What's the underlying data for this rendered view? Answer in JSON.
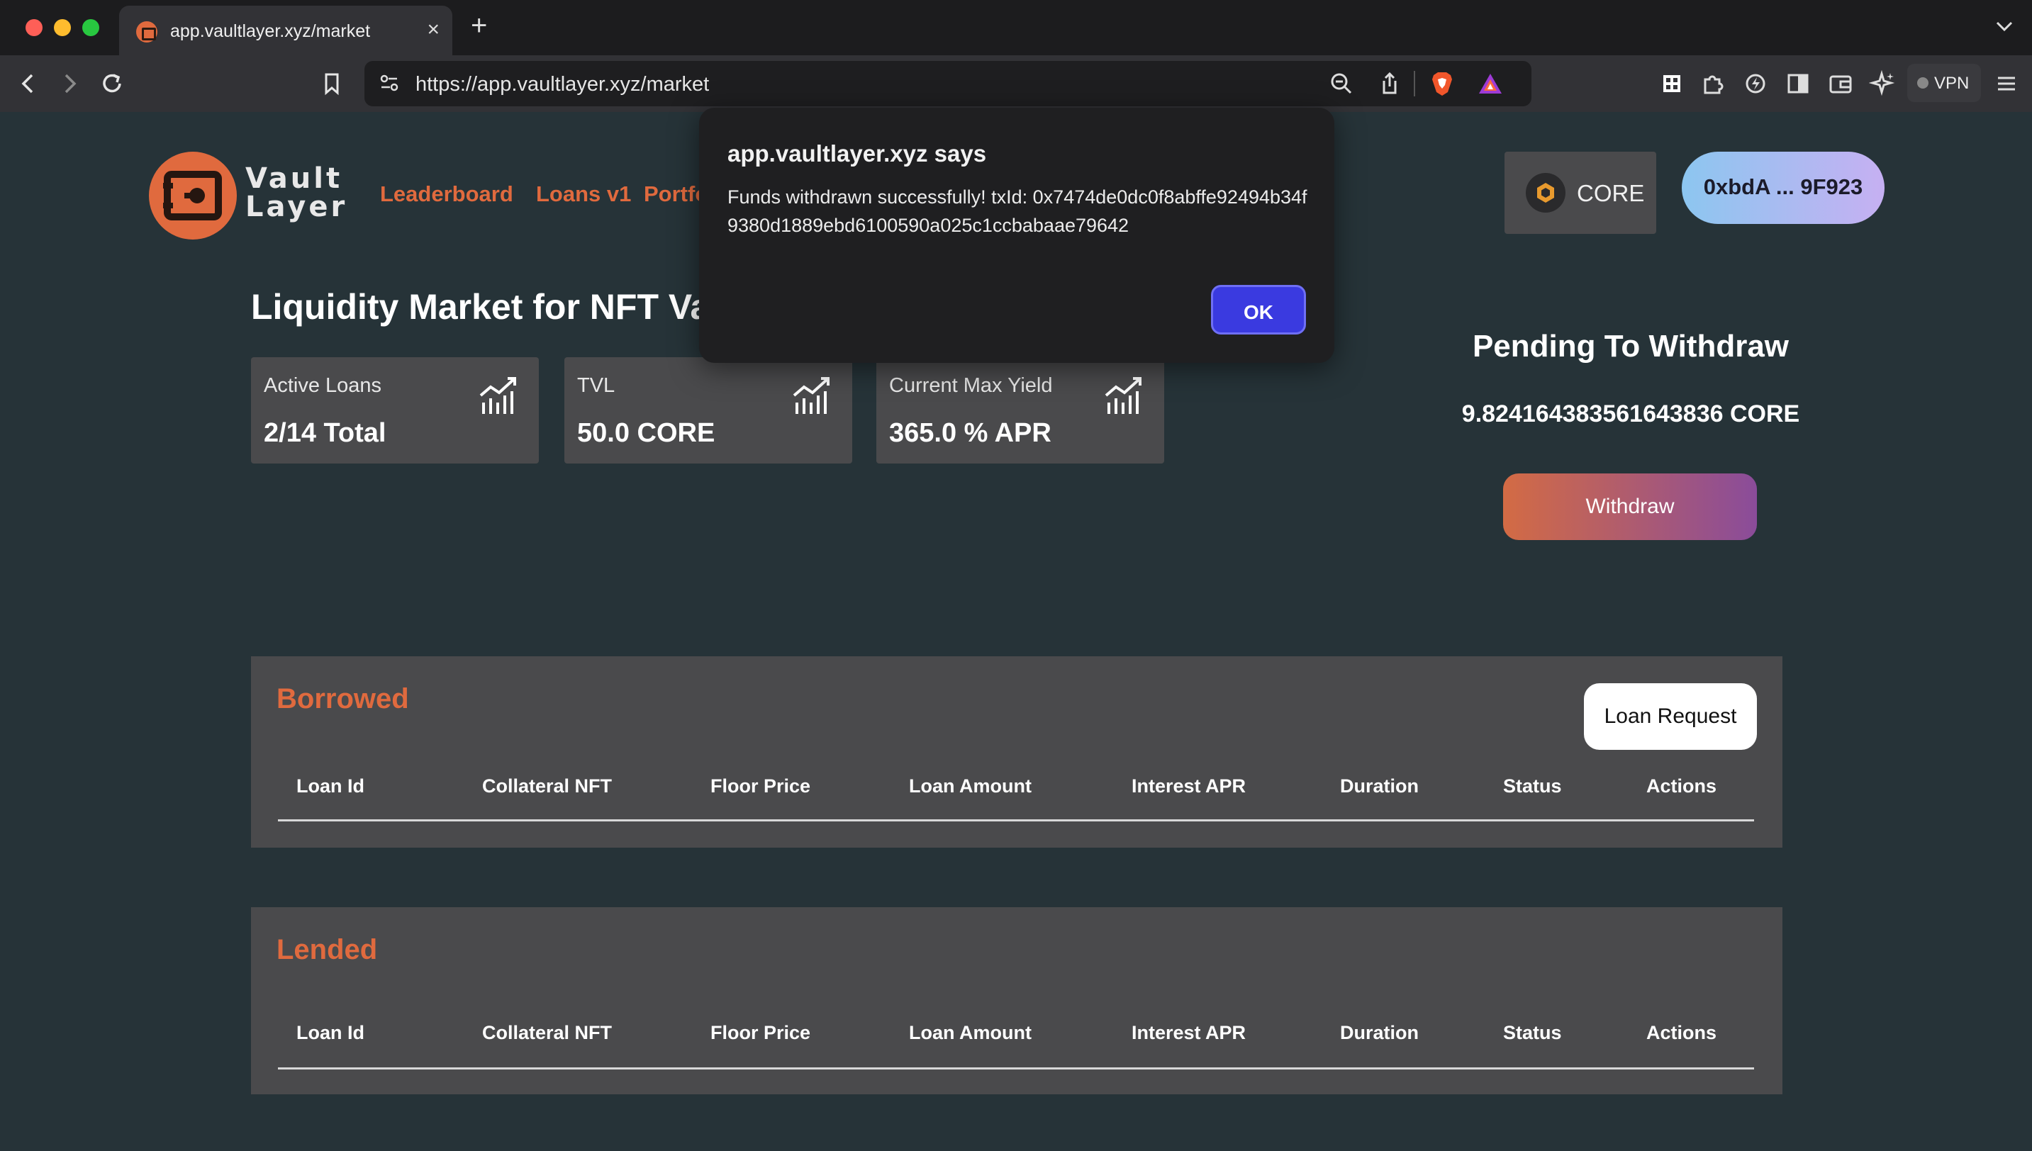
{
  "browser": {
    "tab_title": "app.vaultlayer.xyz/market",
    "tab_close": "×",
    "new_tab": "+",
    "url": "https://app.vaultlayer.xyz/market",
    "vpn_label": "VPN"
  },
  "header": {
    "logo_line1": "Vault",
    "logo_line2": "Layer",
    "nav": [
      "Leaderboard",
      "Loans v1",
      "Portfolio"
    ],
    "chain_label": "CORE",
    "wallet_label": "0xbdA ... 9F923"
  },
  "main": {
    "title": "Liquidity Market for NFT Vaults",
    "stats": [
      {
        "label": "Active Loans",
        "value": "2/14 Total"
      },
      {
        "label": "TVL",
        "value": "50.0 CORE"
      },
      {
        "label": "Current Max Yield",
        "value": "365.0 % APR"
      }
    ],
    "pending": {
      "title": "Pending To Withdraw",
      "amount": "9.824164383561643836 CORE",
      "withdraw_label": "Withdraw"
    }
  },
  "borrowed": {
    "title": "Borrowed",
    "loan_request_label": "Loan Request",
    "columns": [
      "Loan Id",
      "Collateral NFT",
      "Floor Price",
      "Loan Amount",
      "Interest APR",
      "Duration",
      "Status",
      "Actions"
    ]
  },
  "lended": {
    "title": "Lended",
    "columns": [
      "Loan Id",
      "Collateral NFT",
      "Floor Price",
      "Loan Amount",
      "Interest APR",
      "Duration",
      "Status",
      "Actions"
    ]
  },
  "dialog": {
    "title": "app.vaultlayer.xyz says",
    "message": "Funds withdrawn successfully! txId: 0x7474de0dc0f8abffe92494b34f9380d1889ebd6100590a025c1ccbabaae79642",
    "ok_label": "OK"
  },
  "colors": {
    "accent": "#e06a3e",
    "background": "#263338",
    "panel": "#4a4a4c",
    "dialog_button": "#3a3ae0"
  }
}
